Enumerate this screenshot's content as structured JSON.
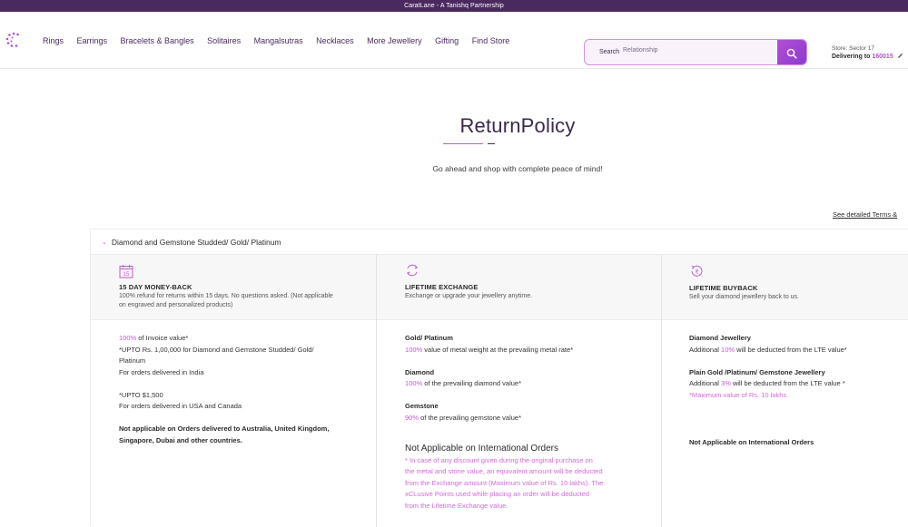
{
  "topbar": {
    "text": "CaratLane - A Tanishq Partnership"
  },
  "nav": {
    "items": [
      "Rings",
      "Earrings",
      "Bracelets & Bangles",
      "Solitaires",
      "Mangalsutras",
      "Necklaces",
      "More Jewellery",
      "Gifting",
      "Find Store"
    ]
  },
  "search": {
    "label": "Search",
    "placeholder": "Relationship"
  },
  "store": {
    "name": "Store: Sector 17",
    "delivering": "Delivering to",
    "pincode": "160015"
  },
  "page": {
    "title": "ReturnPolicy",
    "subtitle": "Go ahead and shop with complete peace of mind!",
    "terms_link": "See detailed Terms & "
  },
  "section": {
    "heading": "Diamond and Gemstone Studded/ Gold/ Platinum",
    "cards": [
      {
        "icon": "calendar-icon",
        "icon_text": "15",
        "title": "15 DAY MONEY-BACK",
        "desc": "100% refund for returns within 15 days. No questions asked. (Not applicable on engraved and personalized products)"
      },
      {
        "icon": "exchange-icon",
        "title": "LIFETIME EXCHANGE",
        "desc": "Exchange or upgrade your jewellery anytime."
      },
      {
        "icon": "buyback-icon",
        "title": "LIFETIME BUYBACK",
        "desc": "Sell your diamond jewellery back to us."
      }
    ],
    "col1": {
      "pct": "100%",
      "pct_rest": " of Invoice value*",
      "line2": "*UPTO Rs. 1,00,000 for Diamond and Gemstone Studded/ Gold/",
      "line3": "Platinum",
      "line4": "For orders delivered in India",
      "line5": "*UPTO $1,500",
      "line6": "For orders delivered in USA and Canada",
      "na1": "Not applicable on Orders delivered to Australia, United Kingdom,",
      "na2": "Singapore, Dubai and other countries."
    },
    "col2": {
      "gold_title": "Gold/ Platinum",
      "gold_pct": "100%",
      "gold_rest": " value of metal weight at the prevailing metal rate*",
      "dia_title": "Diamond",
      "dia_pct": "100%",
      "dia_rest": " of the prevailing diamond value*",
      "gem_title": "Gemstone",
      "gem_pct": "90%",
      "gem_rest": " of the prevailing gemstone value*",
      "na_title": "Not Applicable on International Orders",
      "note1": "* In case of any discount given during the original purchase on",
      "note2": "the metal and stone value, an equivalent amount will be deducted",
      "note3": "from the Exchange amount (Maximum value of Rs. 10 lakhs). The",
      "note4": "xCLusive Points used while placing an order will be deducted",
      "note5": "from the Lifetime Exchange value."
    },
    "col3": {
      "dj_title": "Diamond Jewellery",
      "dj_pre": "Additional ",
      "dj_pct": "10%",
      "dj_rest": " will be deducted from the LTE value*",
      "pg_title": "Plain Gold /Platinum/ Gemstone Jewellery",
      "pg_pre": "Additional ",
      "pg_pct": "3%",
      "pg_rest": " will be deducted from the LTE value *",
      "pg_max": "*Maximum value of Rs. 10 lakhs",
      "na_title": "Not Applicable on International Orders"
    }
  },
  "colors": {
    "brand": "#4a2a5e",
    "accent": "#c05ad6"
  }
}
